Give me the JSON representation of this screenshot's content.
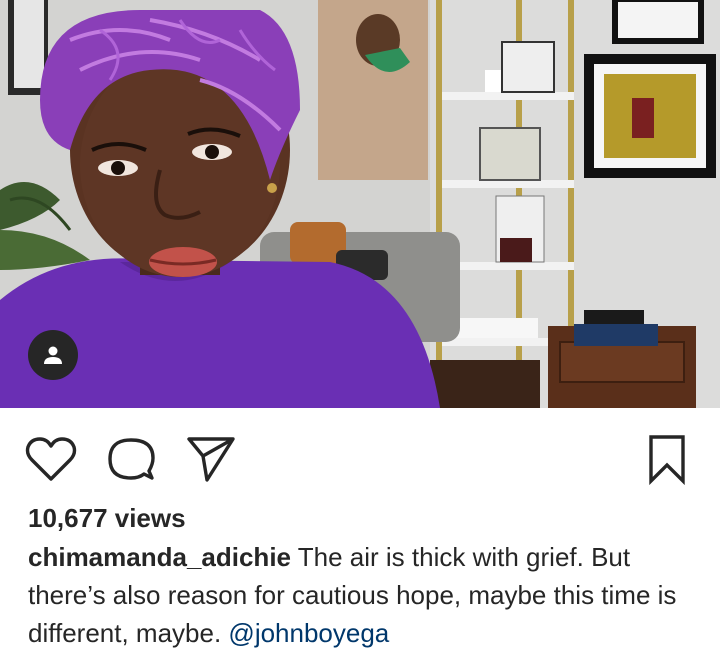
{
  "post": {
    "views": "10,677 views",
    "username": "chimamanda_adichie",
    "caption_text": "The air is thick with grief. But there’s also reason for cautious hope, maybe this time is different, maybe.",
    "mention": "@johnboyega"
  },
  "icons": {
    "like": "heart-outline-icon",
    "comment": "speech-bubble-icon",
    "share": "paper-plane-icon",
    "save": "bookmark-outline-icon",
    "tagged_user": "person-icon"
  },
  "colors": {
    "text": "#262626",
    "mention": "#00376b",
    "background": "#ffffff"
  }
}
